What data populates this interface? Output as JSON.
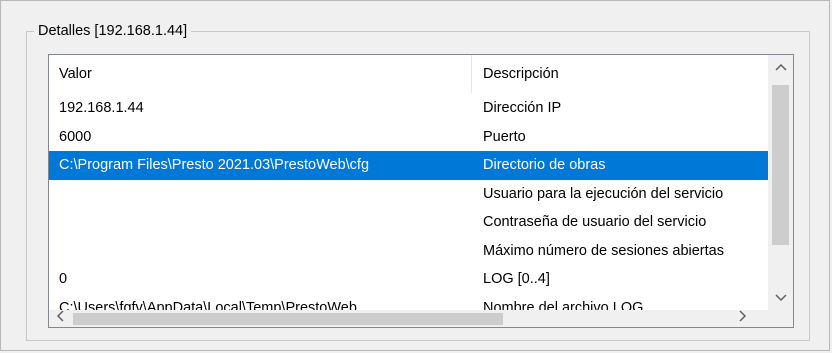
{
  "groupbox": {
    "title": "Detalles [192.168.1.44]"
  },
  "table": {
    "columns": [
      "Valor",
      "Descripción"
    ],
    "rows": [
      {
        "valor": "192.168.1.44",
        "descripcion": "Dirección IP",
        "selected": false
      },
      {
        "valor": "6000",
        "descripcion": "Puerto",
        "selected": false
      },
      {
        "valor": "C:\\Program Files\\Presto 2021.03\\PrestoWeb\\cfg",
        "descripcion": "Directorio de obras",
        "selected": true
      },
      {
        "valor": "",
        "descripcion": "Usuario para la ejecución del servicio",
        "selected": false
      },
      {
        "valor": "",
        "descripcion": "Contraseña de usuario del servicio",
        "selected": false
      },
      {
        "valor": "",
        "descripcion": "Máximo número de sesiones abiertas",
        "selected": false
      },
      {
        "valor": "0",
        "descripcion": "LOG [0..4]",
        "selected": false
      },
      {
        "valor": "C:\\Users\\fgfv\\AppData\\Local\\Temp\\PrestoWeb...",
        "descripcion": "Nombre del archivo LOG",
        "selected": false
      }
    ]
  },
  "scrollbars": {
    "up_arrow": "^",
    "down_arrow": "v",
    "left_arrow": "<",
    "right_arrow": ">"
  },
  "colors": {
    "selection": "#0078d7",
    "background": "#f0f0f0",
    "list_background": "#ffffff"
  }
}
